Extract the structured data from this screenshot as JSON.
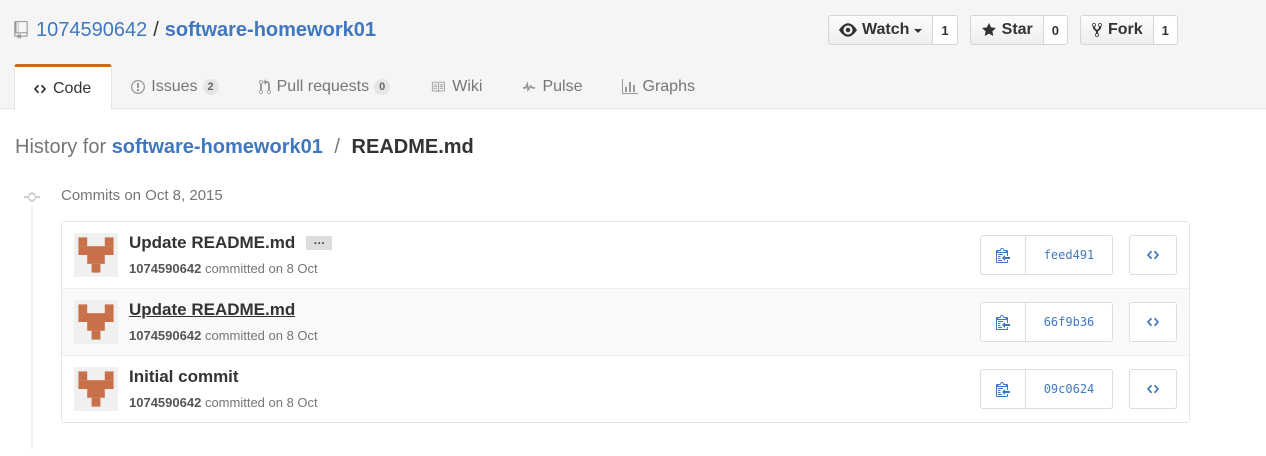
{
  "repo": {
    "owner": "1074590642",
    "separator": "/",
    "name": "software-homework01"
  },
  "actions": {
    "watch": {
      "label": "Watch",
      "count": "1"
    },
    "star": {
      "label": "Star",
      "count": "0"
    },
    "fork": {
      "label": "Fork",
      "count": "1"
    }
  },
  "tabs": [
    {
      "label": "Code",
      "icon": "code-icon"
    },
    {
      "label": "Issues",
      "badge": "2",
      "icon": "issue-icon"
    },
    {
      "label": "Pull requests",
      "badge": "0",
      "icon": "pull-request-icon"
    },
    {
      "label": "Wiki",
      "icon": "book-icon"
    },
    {
      "label": "Pulse",
      "icon": "pulse-icon"
    },
    {
      "label": "Graphs",
      "icon": "graph-icon"
    }
  ],
  "history": {
    "prefix": "History for",
    "repo": "software-homework01",
    "separator": "/",
    "file": "README.md"
  },
  "commits_date": "Commits on Oct 8, 2015",
  "commits": [
    {
      "message": "Update README.md",
      "ellipsis": "…",
      "author": "1074590642",
      "committed": "committed on 8 Oct",
      "sha": "feed491"
    },
    {
      "message": "Update README.md",
      "author": "1074590642",
      "committed": "committed on 8 Oct",
      "sha": "66f9b36"
    },
    {
      "message": "Initial commit",
      "author": "1074590642",
      "committed": "committed on 8 Oct",
      "sha": "09c0624"
    }
  ],
  "colors": {
    "link": "#4078c0",
    "tab_accent": "#d26911",
    "avatar": "#c8704a"
  }
}
